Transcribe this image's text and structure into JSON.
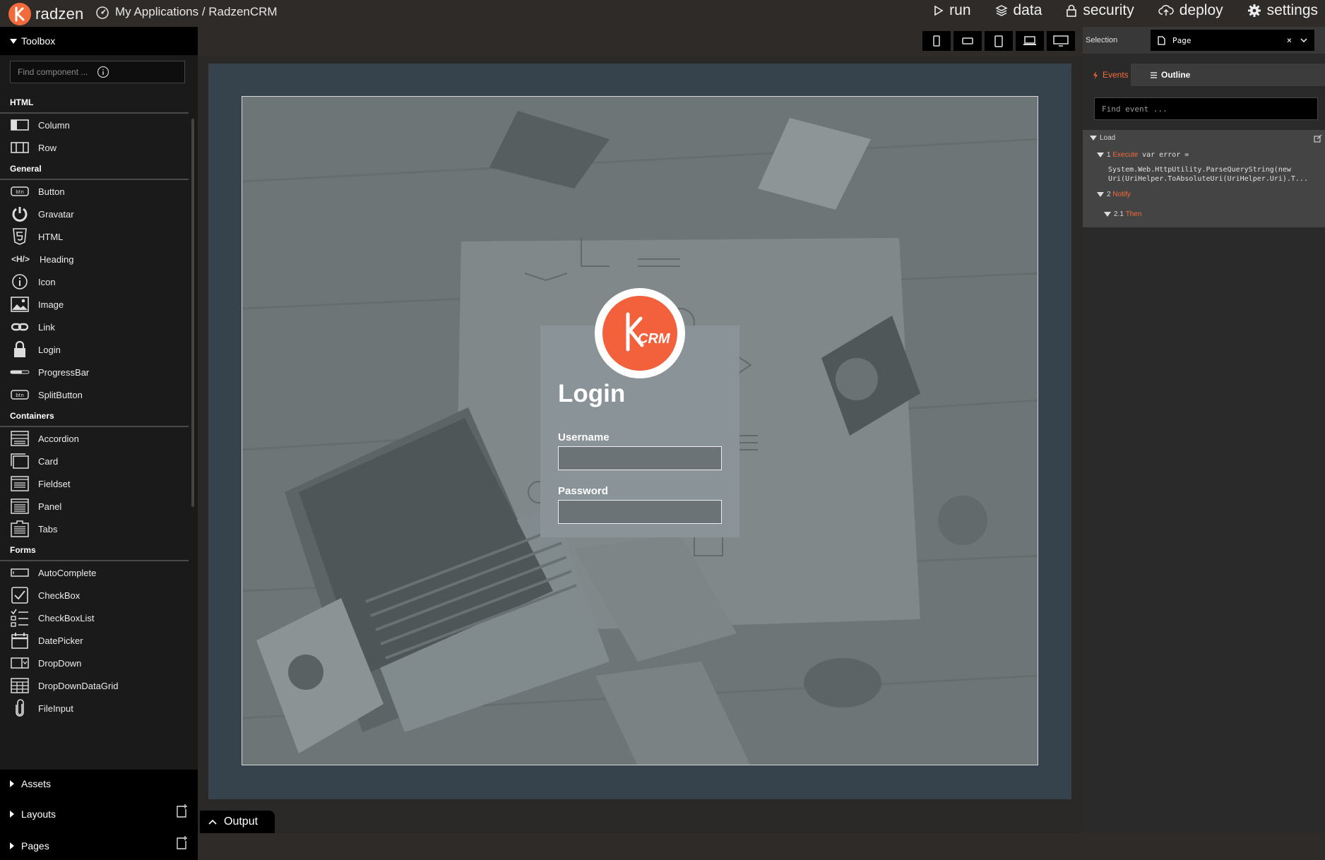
{
  "app": {
    "brand": "radzen",
    "breadcrumb": "My Applications / RadzenCRM",
    "nav": [
      {
        "label": "run",
        "icon": "play-icon"
      },
      {
        "label": "data",
        "icon": "layers-icon"
      },
      {
        "label": "security",
        "icon": "lock-icon"
      },
      {
        "label": "deploy",
        "icon": "cloud-upload-icon"
      },
      {
        "label": "settings",
        "icon": "gear-icon"
      }
    ]
  },
  "toolbox": {
    "title": "Toolbox",
    "search_placeholder": "Find component ...",
    "sections": [
      {
        "title": "HTML",
        "items": [
          {
            "label": "Column",
            "icon": "column-icon"
          },
          {
            "label": "Row",
            "icon": "row-icon"
          }
        ]
      },
      {
        "title": "General",
        "items": [
          {
            "label": "Button",
            "icon": "button-icon"
          },
          {
            "label": "Gravatar",
            "icon": "gravatar-icon"
          },
          {
            "label": "HTML",
            "icon": "html5-icon"
          },
          {
            "label": "Heading",
            "icon": "heading-icon"
          },
          {
            "label": "Icon",
            "icon": "info-icon"
          },
          {
            "label": "Image",
            "icon": "image-icon"
          },
          {
            "label": "Link",
            "icon": "link-icon"
          },
          {
            "label": "Login",
            "icon": "lock-icon"
          },
          {
            "label": "ProgressBar",
            "icon": "progressbar-icon"
          },
          {
            "label": "SplitButton",
            "icon": "button-icon"
          }
        ]
      },
      {
        "title": "Containers",
        "items": [
          {
            "label": "Accordion",
            "icon": "accordion-icon"
          },
          {
            "label": "Card",
            "icon": "card-icon"
          },
          {
            "label": "Fieldset",
            "icon": "fieldset-icon"
          },
          {
            "label": "Panel",
            "icon": "panel-icon"
          },
          {
            "label": "Tabs",
            "icon": "tabs-icon"
          }
        ]
      },
      {
        "title": "Forms",
        "items": [
          {
            "label": "AutoComplete",
            "icon": "autocomplete-icon"
          },
          {
            "label": "CheckBox",
            "icon": "checkbox-icon"
          },
          {
            "label": "CheckBoxList",
            "icon": "checkboxlist-icon"
          },
          {
            "label": "DatePicker",
            "icon": "calendar-icon"
          },
          {
            "label": "DropDown",
            "icon": "dropdown-icon"
          },
          {
            "label": "DropDownDataGrid",
            "icon": "grid-icon"
          },
          {
            "label": "FileInput",
            "icon": "paperclip-icon"
          }
        ]
      }
    ],
    "bottom": [
      {
        "label": "Assets"
      },
      {
        "label": "Layouts"
      },
      {
        "label": "Pages"
      }
    ]
  },
  "canvas": {
    "login": {
      "title": "Login",
      "logo_text": "CRM",
      "username_label": "Username",
      "password_label": "Password",
      "username_value": "",
      "password_value": ""
    },
    "output_label": "Output"
  },
  "properties": {
    "selection_label": "Selection",
    "selected": "Page",
    "tabs": {
      "events": "Events",
      "outline": "Outline"
    },
    "find_event_placeholder": "Find event ...",
    "event_name": "Load",
    "steps": {
      "s1_num": "1",
      "s1_action": "Execute",
      "s1_code_a": "var error =",
      "s1_code_b": "System.Web.HttpUtility.ParseQueryString(new",
      "s1_code_c": "Uri(UriHelper.ToAbsoluteUri(UriHelper.Uri).T...",
      "s2_num": "2",
      "s2_action": "Notify",
      "s21_num": "2.1",
      "s21_action": "Then"
    }
  },
  "colors": {
    "accent": "#f26b3a",
    "toolbox_bg": "#1a1a1a",
    "frame": "#36434c"
  }
}
